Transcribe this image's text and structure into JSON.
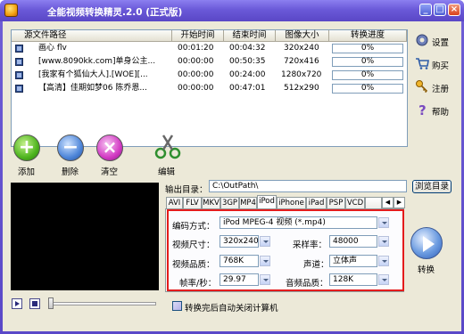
{
  "window": {
    "title": "全能视频转换精灵.2.0 (正式版)"
  },
  "filelist": {
    "columns": [
      "源文件路径",
      "开始时间",
      "结束时间",
      "图像大小",
      "转换进度"
    ],
    "rows": [
      {
        "path": "画心 flv",
        "start": "00:01:20",
        "end": "00:04:32",
        "size": "320x240",
        "progress": 0
      },
      {
        "path": "[www.8090kk.com]单身公主...",
        "start": "00:00:00",
        "end": "00:50:35",
        "size": "720x416",
        "progress": 0
      },
      {
        "path": "[我家有个狐仙大人].[WOE][...",
        "start": "00:00:00",
        "end": "00:24:00",
        "size": "1280x720",
        "progress": 0
      },
      {
        "path": "【高清】佳期如梦06 陈乔恩...",
        "start": "00:00:00",
        "end": "00:47:01",
        "size": "512x290",
        "progress": 0
      }
    ]
  },
  "side": {
    "settings": "设置",
    "buy": "购买",
    "register": "注册",
    "help": "帮助"
  },
  "actions": {
    "add": "添加",
    "delete": "删除",
    "clear": "清空",
    "edit": "编辑"
  },
  "output": {
    "label": "输出目录：",
    "path": "C:\\OutPath\\",
    "browse": "浏览目录"
  },
  "tabs": [
    "AVI",
    "FLV",
    "MKV",
    "3GP",
    "MP4",
    "iPod",
    "iPhone",
    "iPad",
    "PSP",
    "VCD"
  ],
  "active_tab": "iPod",
  "settings": {
    "codec_label": "编码方式：",
    "codec_value": "iPod MPEG-4 视频 (*.mp4)",
    "video_size_label": "视频尺寸：",
    "video_size_value": "320x240",
    "sample_rate_label": "采样率：",
    "sample_rate_value": "48000",
    "video_quality_label": "视频品质：",
    "video_quality_value": "768K",
    "channel_label": "声道：",
    "channel_value": "立体声",
    "fps_label": "帧率/秒：",
    "fps_value": "29.97",
    "audio_quality_label": "音频品质：",
    "audio_quality_value": "128K"
  },
  "convert": {
    "label": "转换"
  },
  "shutdown_checkbox": {
    "label": "转换完后自动关闭计算机",
    "checked": false
  },
  "colors": {
    "titlebar": "#6a59d8",
    "client_bg": "#ece9d8",
    "highlight_frame": "#e41b1b"
  }
}
